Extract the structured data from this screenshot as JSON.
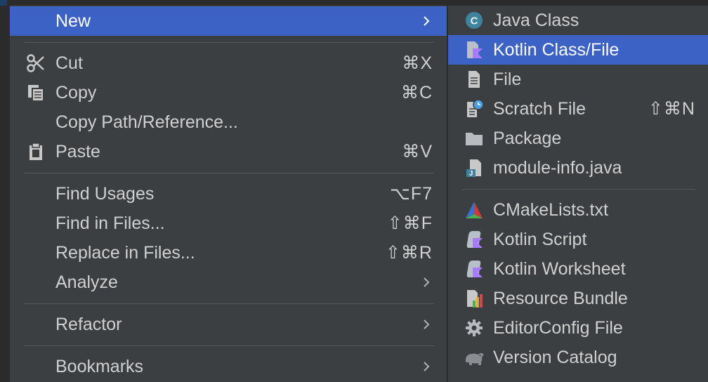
{
  "main_menu": {
    "new_label": "New",
    "cut_label": "Cut",
    "cut_shortcut": "⌘X",
    "copy_label": "Copy",
    "copy_shortcut": "⌘C",
    "copy_path_label": "Copy Path/Reference...",
    "paste_label": "Paste",
    "paste_shortcut": "⌘V",
    "find_usages_label": "Find Usages",
    "find_usages_shortcut": "⌥F7",
    "find_in_files_label": "Find in Files...",
    "find_in_files_shortcut": "⇧⌘F",
    "replace_in_files_label": "Replace in Files...",
    "replace_in_files_shortcut": "⇧⌘R",
    "analyze_label": "Analyze",
    "refactor_label": "Refactor",
    "bookmarks_label": "Bookmarks"
  },
  "sub_menu": {
    "java_class_label": "Java Class",
    "java_class_icon_letter": "C",
    "kotlin_class_label": "Kotlin Class/File",
    "file_label": "File",
    "scratch_file_label": "Scratch File",
    "scratch_file_shortcut": "⇧⌘N",
    "package_label": "Package",
    "module_info_label": "module-info.java",
    "module_info_icon_letter": "J",
    "cmakelists_label": "CMakeLists.txt",
    "kotlin_script_label": "Kotlin Script",
    "kotlin_worksheet_label": "Kotlin Worksheet",
    "resource_bundle_label": "Resource Bundle",
    "editorconfig_label": "EditorConfig File",
    "version_catalog_label": "Version Catalog"
  },
  "colors": {
    "menu_background": "#3c3f41",
    "selection": "#3b62c4",
    "text": "#d0d0d0",
    "kotlin_accent": "#a97bff",
    "java_class_blue": "#40839f"
  }
}
